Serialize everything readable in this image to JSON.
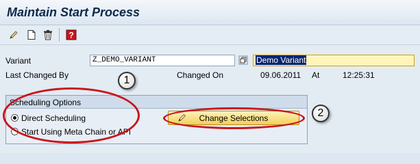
{
  "header": {
    "title": "Maintain Start Process"
  },
  "toolbar": {
    "icons": [
      "edit-icon",
      "new-page-icon",
      "delete-icon",
      "help-icon"
    ]
  },
  "form": {
    "variant_label": "Variant",
    "variant_value": "Z_DEMO_VARIANT",
    "variant_description": "Demo Variant",
    "last_changed_by_label": "Last Changed By",
    "changed_on_label": "Changed On",
    "changed_on_value": "09.06.2011",
    "at_label": "At",
    "at_value": "12:25:31"
  },
  "scheduling": {
    "title": "Scheduling Options",
    "option_direct": "Direct Scheduling",
    "option_meta": "Start Using Meta Chain or API",
    "selected": "Direct Scheduling",
    "change_button": "Change Selections"
  },
  "annotations": {
    "one": "1",
    "two": "2"
  },
  "colors": {
    "annotation_red": "#c8161d",
    "button_yellow": "#f3cf5c",
    "field_highlight": "#fff5b8"
  }
}
